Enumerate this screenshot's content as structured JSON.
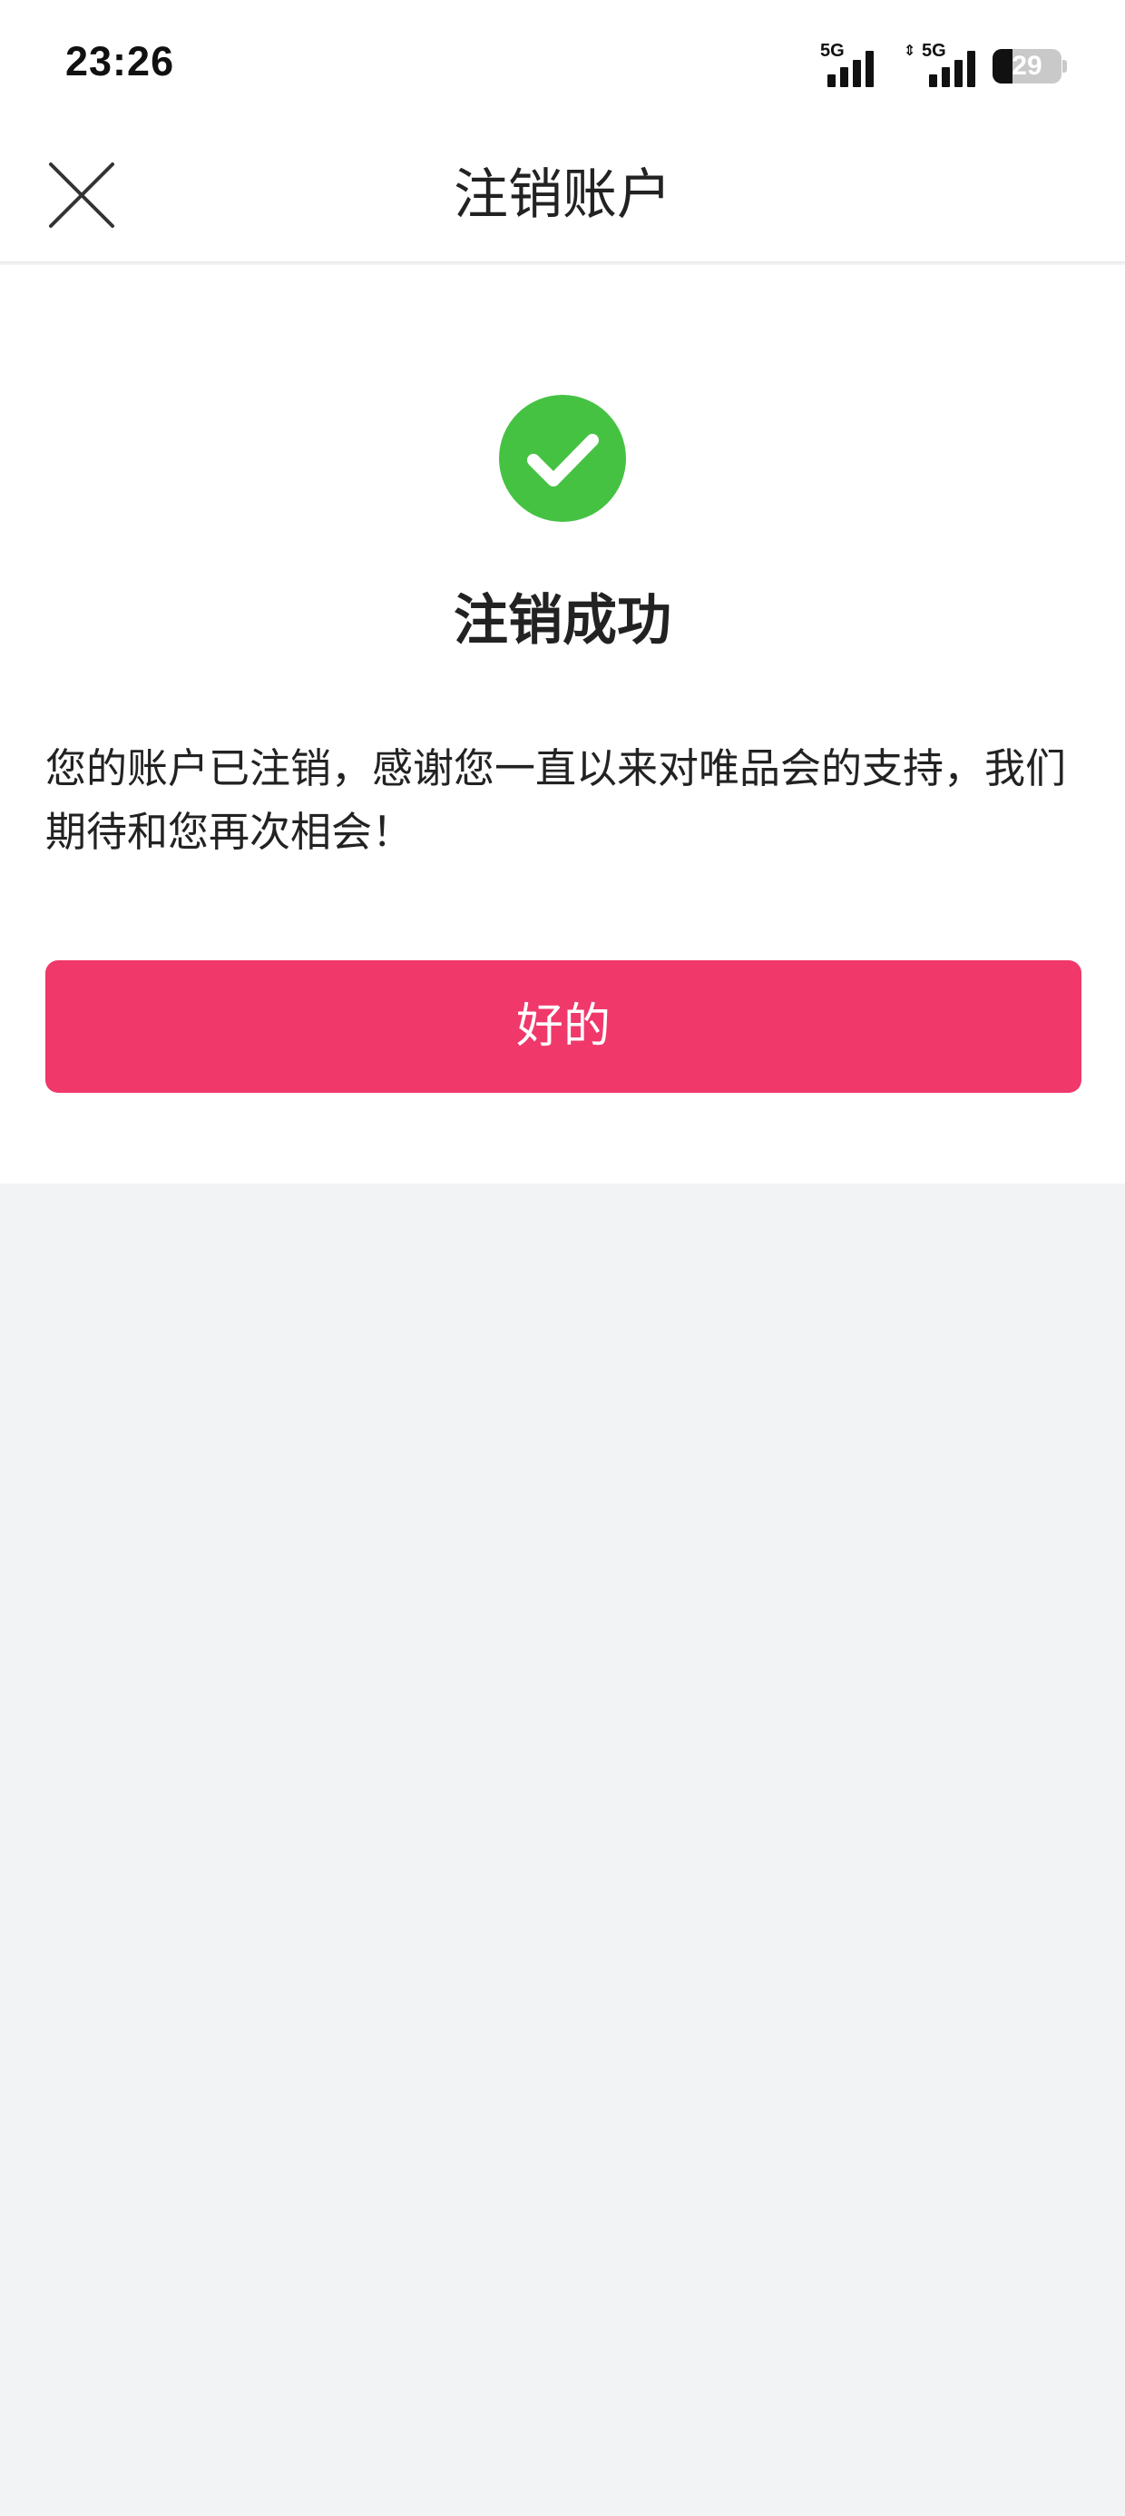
{
  "status_bar": {
    "time": "23:26",
    "sim1_network": "5G",
    "sim2_network": "5G",
    "battery_level": "29",
    "battery_fraction": 0.29,
    "signal_icon": "signal-bars-icon",
    "battery_icon": "battery-icon"
  },
  "nav": {
    "title": "注销账户",
    "close_icon": "close-icon"
  },
  "result": {
    "icon": "success-check-icon",
    "icon_color": "#46c243",
    "title": "注销成功",
    "message": "您的账户已注销，感谢您一直以来对唯品会的支持，我们期待和您再次相会！"
  },
  "actions": {
    "ok_label": "好的",
    "ok_color": "#f0386b"
  }
}
